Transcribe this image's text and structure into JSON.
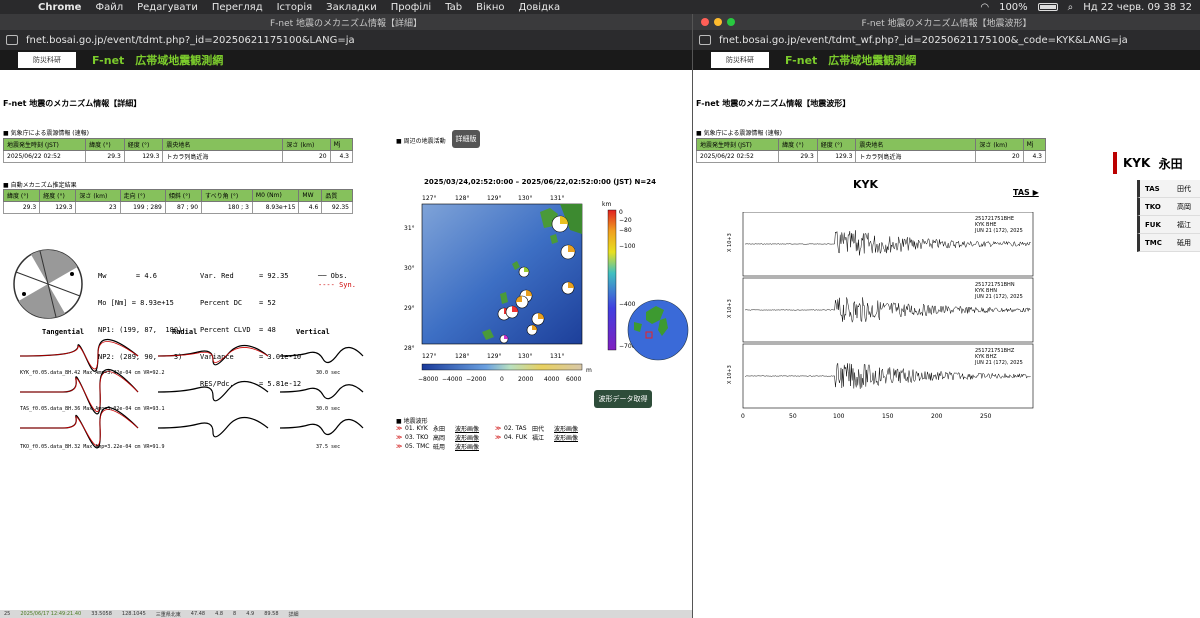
{
  "menubar": {
    "app": "Chrome",
    "items": [
      "Файл",
      "Редагувати",
      "Перегляд",
      "Історія",
      "Закладки",
      "Профілі",
      "Tab",
      "Вікно",
      "Довідка"
    ],
    "battery": "100%",
    "datetime": "Нд 22 черв.  09 38 32"
  },
  "left": {
    "window_title": "F-net 地震のメカニズム情報【詳細】",
    "url": "fnet.bosai.go.jp/event/tdmt.php?_id=20250621175100&LANG=ja",
    "logo": "防災科研",
    "site_title": "F-net　広帯域地震観測網",
    "page_title": "F-net 地震のメカニズム情報【詳細】",
    "jma_section": "気象庁による震源情報 (速報)",
    "jma_headers": [
      "地震発生時刻 (JST)",
      "緯度 (°)",
      "経度 (°)",
      "震央地名",
      "深さ (km)",
      "Mj"
    ],
    "jma_row": [
      "2025/06/22 02:52",
      "29.3",
      "129.3",
      "トカラ列島近海",
      "20",
      "4.3"
    ],
    "auto_section": "自動メカニズム推定結果",
    "auto_headers": [
      "緯度 (°)",
      "経度 (°)",
      "深さ (km)",
      "走向 (°)",
      "傾斜 (°)",
      "すべり角 (°)",
      "M0 (Nm)",
      "MW",
      "品質"
    ],
    "auto_row": [
      "29.3",
      "129.3",
      "23",
      "199 ; 289",
      "87 ; 90",
      "180 ; 3",
      "8.93e+15",
      "4.6",
      "92.35"
    ],
    "params_left": [
      "Mw       = 4.6",
      "Mo [Nm] = 8.93e+15",
      "NP1: (199, 87,  180)",
      "NP2: (289, 90,    3)"
    ],
    "params_right": [
      "Var. Red      = 92.35",
      "Percent DC    = 52",
      "Percent CLVD  = 48",
      "Variance      = 3.01e-10",
      "RES/Pdc.      = 5.81e-12"
    ],
    "legend_obs": "Obs.",
    "legend_syn": "Syn.",
    "wave_cols": [
      "Tangential",
      "Radial",
      "Vertical"
    ],
    "wave_rows": [
      {
        "label": "KYK_f0.05.data_BH.42   Max Amp=3.42e-04 cm   VR=92.2",
        "scale": "30.0 sec"
      },
      {
        "label": "TAS_f0.05.data_BH.36   Max Amp=3.02e-04 cm   VR=93.1",
        "scale": "30.0 sec"
      },
      {
        "label": "TKO_f0.05.data_BH.32   Max Amp=3.22e-04 cm   VR=91.9",
        "scale": "37.5 sec"
      }
    ],
    "nearby_section": "周辺の地震活動",
    "detail_button": "詳細版",
    "map_title": "2025/03/24,02:52:0:00 – 2025/06/22,02:52:0:00 (JST)  N=24",
    "lon_ticks": [
      "127°",
      "128°",
      "129°",
      "130°",
      "131°"
    ],
    "lat_ticks": [
      "31°",
      "30°",
      "29°",
      "28°"
    ],
    "depth_unit": "km",
    "depth_ticks": [
      "0",
      "−20",
      "−80",
      "−100",
      "−400",
      "−700"
    ],
    "elev_ticks": [
      "−8000",
      "−4000",
      "−2000",
      "0",
      "2000",
      "4000",
      "6000"
    ],
    "elev_unit": "m",
    "waveform_button": "波形データ取得",
    "waveform_section": "地震波形",
    "stations": [
      {
        "code": "01. KYK",
        "name": "永田",
        "link": "波形画像"
      },
      {
        "code": "02. TAS",
        "name": "田代",
        "link": "波形画像"
      },
      {
        "code": "03. TKO",
        "name": "高岡",
        "link": "波形画像"
      },
      {
        "code": "04. FUK",
        "name": "福江",
        "link": "波形画像"
      },
      {
        "code": "05. TMC",
        "name": "砥用",
        "link": "波形画像"
      }
    ],
    "status_row": [
      "25",
      "2025/06/17 12:49:21.40",
      "33.5058",
      "128.1045",
      "三重県北東",
      "47.48",
      "4.8",
      "8",
      "4.9",
      "89.58",
      "詳細"
    ]
  },
  "right": {
    "window_title": "F-net 地震のメカニズム情報【地震波形】",
    "url": "fnet.bosai.go.jp/event/tdmt_wf.php?_id=20250621175100&_code=KYK&LANG=ja",
    "logo": "防災科研",
    "site_title": "F-net　広帯域地震観測網",
    "page_title": "F-net 地震のメカニズム情報【地震波形】",
    "jma_section": "気象庁による震源情報 (速報)",
    "jma_headers": [
      "地震発生時刻 (JST)",
      "緯度 (°)",
      "経度 (°)",
      "震央地名",
      "深さ (km)",
      "Mj"
    ],
    "jma_row": [
      "2025/06/22 02:52",
      "29.3",
      "129.3",
      "トカラ列島近海",
      "20",
      "4.3"
    ],
    "station_head_code": "KYK",
    "station_head_name": "永田",
    "other_stations": [
      {
        "code": "TAS",
        "name": "田代"
      },
      {
        "code": "TKO",
        "name": "高岡"
      },
      {
        "code": "FUK",
        "name": "福江"
      },
      {
        "code": "TMC",
        "name": "砥用"
      }
    ],
    "seis_title": "KYK",
    "next_link": "TAS ▶",
    "channels": [
      {
        "id": "251721751BHE",
        "l2": "KYK  BHE",
        "l3": "JUN 21 (172), 2025",
        "ylabel": "X 10+3"
      },
      {
        "id": "251721751BHN",
        "l2": "KYK  BHN",
        "l3": "JUN 21 (172), 2025",
        "ylabel": "X 10+3"
      },
      {
        "id": "251721751BHZ",
        "l2": "KYK  BHZ",
        "l3": "JUN 21 (172), 2025",
        "ylabel": "X 10+3"
      }
    ],
    "x_ticks": [
      "0",
      "50",
      "100",
      "150",
      "200",
      "250"
    ]
  }
}
